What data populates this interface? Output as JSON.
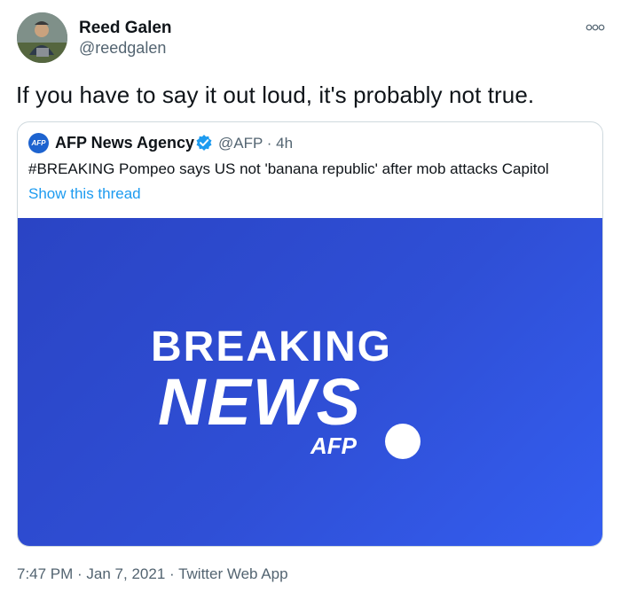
{
  "author": {
    "name": "Reed Galen",
    "handle": "@reedgalen"
  },
  "tweet": {
    "text": "If you have to say it out loud, it's probably not true."
  },
  "quoted_tweet": {
    "avatar_label": "AFP",
    "name": "AFP News Agency",
    "handle_time": "@AFP · 4h",
    "text": "#BREAKING Pompeo says US not 'banana republic' after mob attacks Capitol",
    "link": "Show this thread",
    "media": {
      "line1": "BREAKING",
      "line2": "NEWS",
      "brand": "AFP"
    }
  },
  "meta": {
    "timestamp": "7:47 PM · Jan 7, 2021 · Twitter Web App"
  },
  "colors": {
    "accent": "#1d9bf0",
    "media_blue": "#2f4fd6",
    "secondary_text": "#536471"
  },
  "icons": {
    "more": "more-horizontal-icon",
    "verified": "verified-badge-icon"
  }
}
